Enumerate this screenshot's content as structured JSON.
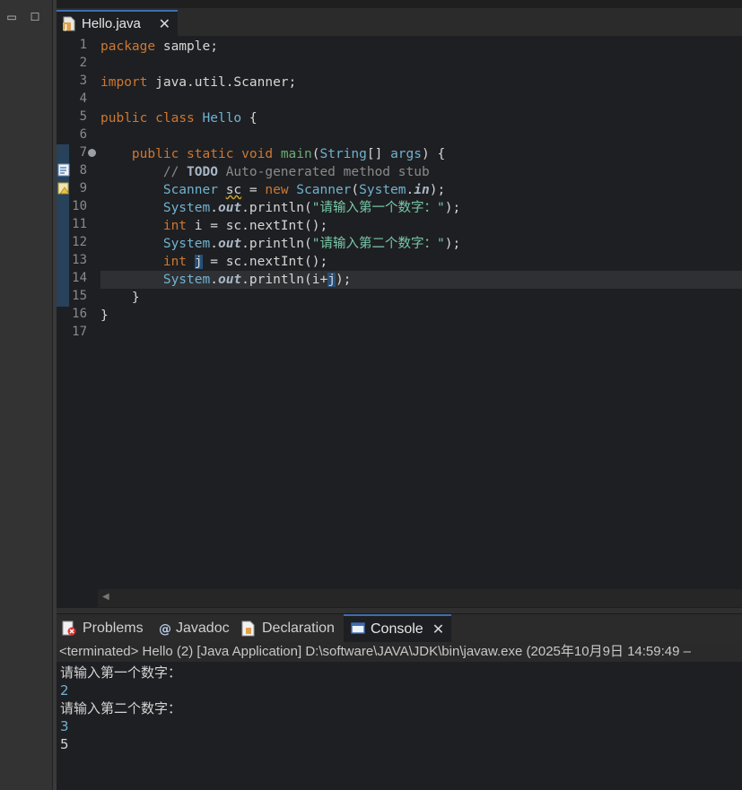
{
  "editor_tab": {
    "label": "Hello.java",
    "close": "✕"
  },
  "line_numbers": [
    "1",
    "2",
    "3",
    "4",
    "5",
    "6",
    "7",
    "8",
    "9",
    "10",
    "11",
    "12",
    "13",
    "14",
    "15",
    "16",
    "17"
  ],
  "code": {
    "l1_kw": "package",
    "l1_rest": " sample;",
    "l3_kw": "import",
    "l3_rest": " java.util.Scanner;",
    "l5_kw1": "public",
    "l5_kw2": "class",
    "l5_cls": "Hello",
    "l5_rest": " {",
    "l7_kw1": "public",
    "l7_kw2": "static",
    "l7_kw3": "void",
    "l7_fn": "main",
    "l7_p1": "(",
    "l7_cls": "String",
    "l7_p2": "[] ",
    "l7_arg": "args",
    "l7_rest": ") {",
    "l8_c1": "// ",
    "l8_todo": "TODO",
    "l8_c2": " Auto-generated method stub",
    "l9_cls": "Scanner",
    "l9_var": "sc",
    "l9_eq": " = ",
    "l9_new": "new",
    "l9_cls2": "Scanner",
    "l9_p": "(",
    "l9_sys": "System",
    "l9_dot": ".",
    "l9_fld": "in",
    "l9_end": ");",
    "l10_sys": "System",
    "l10_dot": ".",
    "l10_fld": "out",
    "l10_call": ".println(",
    "l10_str": "\"请输入第一个数字：\"",
    "l10_end": ");",
    "l11_kw": "int",
    "l11_rest": " i = sc.nextInt();",
    "l12_sys": "System",
    "l12_dot": ".",
    "l12_fld": "out",
    "l12_call": ".println(",
    "l12_str": "\"请输入第二个数字：\"",
    "l12_end": ");",
    "l13_kw": "int",
    "l13_var": "j",
    "l13_rest": " = sc.nextInt();",
    "l14_sys": "System",
    "l14_dot": ".",
    "l14_fld": "out",
    "l14_call": ".println(i+",
    "l14_var": "j",
    "l14_end": ");",
    "l15": "}",
    "l16": "}"
  },
  "views": {
    "problems": "Problems",
    "javadoc": "Javadoc",
    "declaration": "Declaration",
    "console": "Console",
    "console_close": "✕"
  },
  "console": {
    "header": "<terminated> Hello (2) [Java Application] D:\\software\\JAVA\\JDK\\bin\\javaw.exe  (2025年10月9日 14:59:49 –",
    "lines": [
      {
        "text": "请输入第一个数字：",
        "kind": "output"
      },
      {
        "text": "2",
        "kind": "input"
      },
      {
        "text": "请输入第二个数字：",
        "kind": "output"
      },
      {
        "text": "3",
        "kind": "input"
      },
      {
        "text": "5",
        "kind": "output"
      }
    ]
  },
  "icons": {
    "java_file": "java-file-icon",
    "problems": "problems-icon",
    "javadoc": "javadoc-icon",
    "declaration": "declaration-icon",
    "console": "console-icon"
  },
  "colors": {
    "keyword": "#cc7832",
    "type": "#6fb3d2",
    "string": "#78c8a8",
    "comment": "#8a8a8a",
    "console_input": "#6fb3d2",
    "active_tab_accent": "#3d6fb0"
  }
}
